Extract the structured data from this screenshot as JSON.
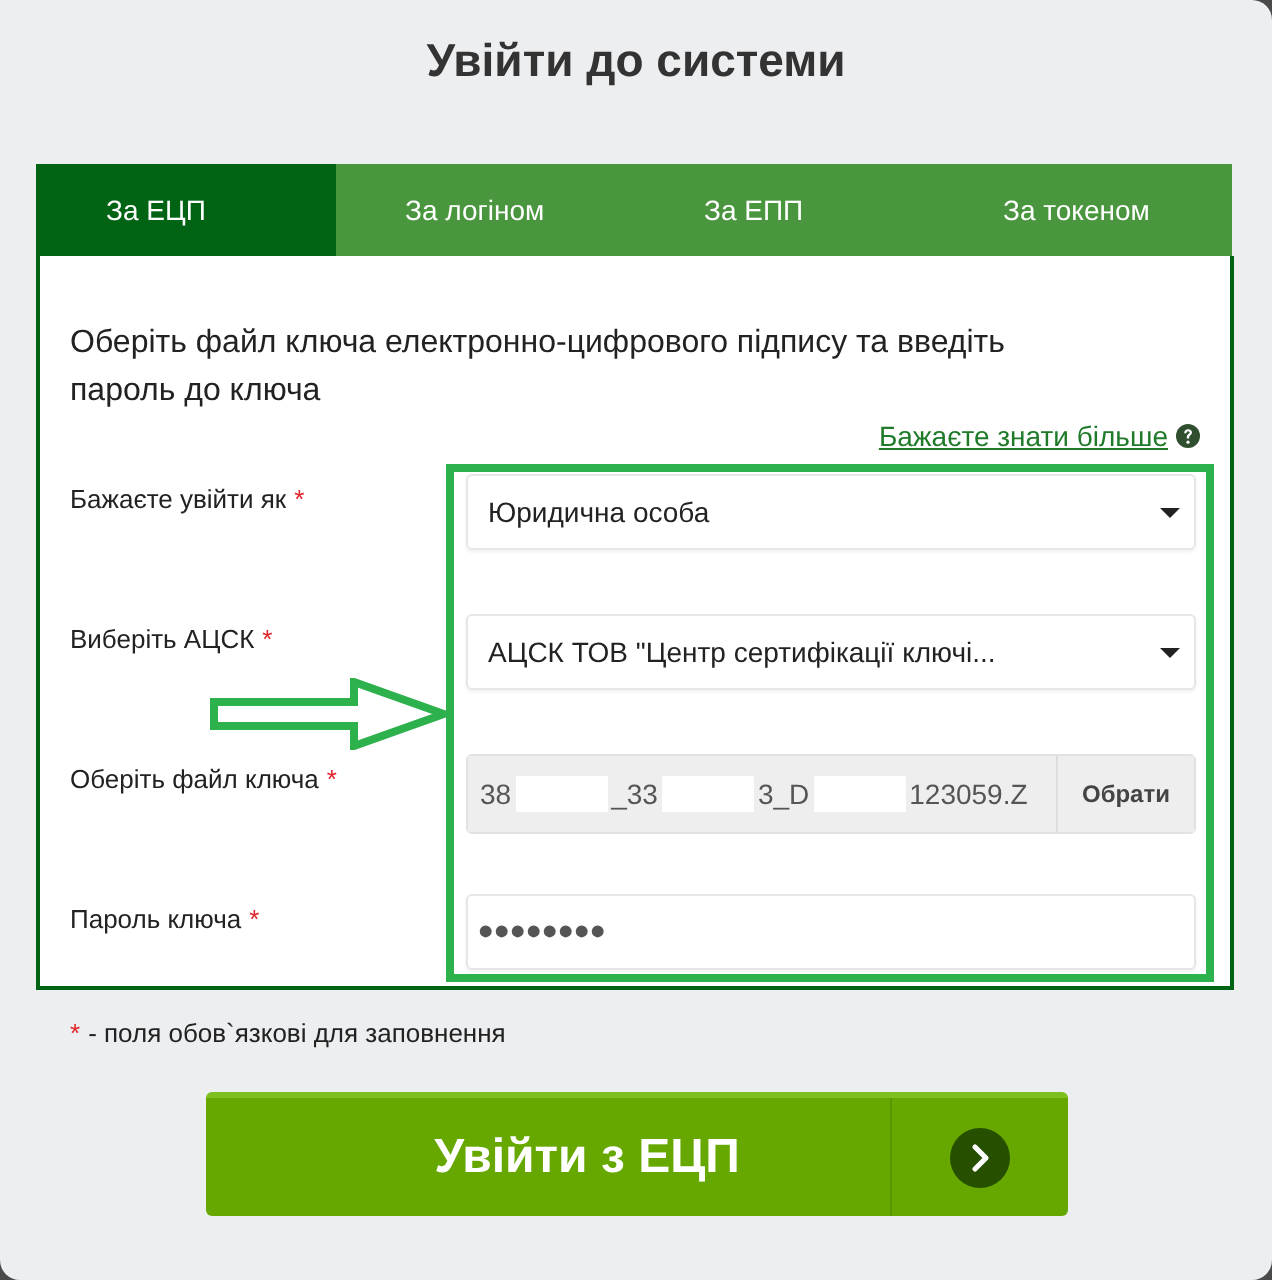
{
  "title": "Увійти до системи",
  "tabs": [
    {
      "label": "За ЕЦП",
      "selected": true
    },
    {
      "label": "За логіном",
      "selected": false
    },
    {
      "label": "За ЕПП",
      "selected": false
    },
    {
      "label": "За токеном",
      "selected": false
    }
  ],
  "instructions": "Оберіть файл ключа електронно-цифрового підпису та введіть пароль до ключа",
  "help_link": "Бажаєте знати більше",
  "fields": [
    {
      "kind": "select",
      "label": "Бажаєте увійти як",
      "required_mark": "*",
      "value": "Юридична особа"
    },
    {
      "kind": "select",
      "label": "Виберіть АЦСК",
      "required_mark": "*",
      "value": "АЦСК ТОВ \"Центр сертифікації ключі..."
    },
    {
      "kind": "file",
      "label": "Оберіть файл ключа",
      "required_mark": "*",
      "value_parts": [
        "38",
        "_33",
        "3_D",
        "123059.Z"
      ],
      "button": "Обрати"
    },
    {
      "kind": "password",
      "label": "Пароль ключа",
      "required_mark": "*",
      "value": "••••••••"
    }
  ],
  "required_note": {
    "mark": "*",
    "text": "- поля обов`язкові для заповнення"
  },
  "submit_button": "Увійти з ЕЦП"
}
